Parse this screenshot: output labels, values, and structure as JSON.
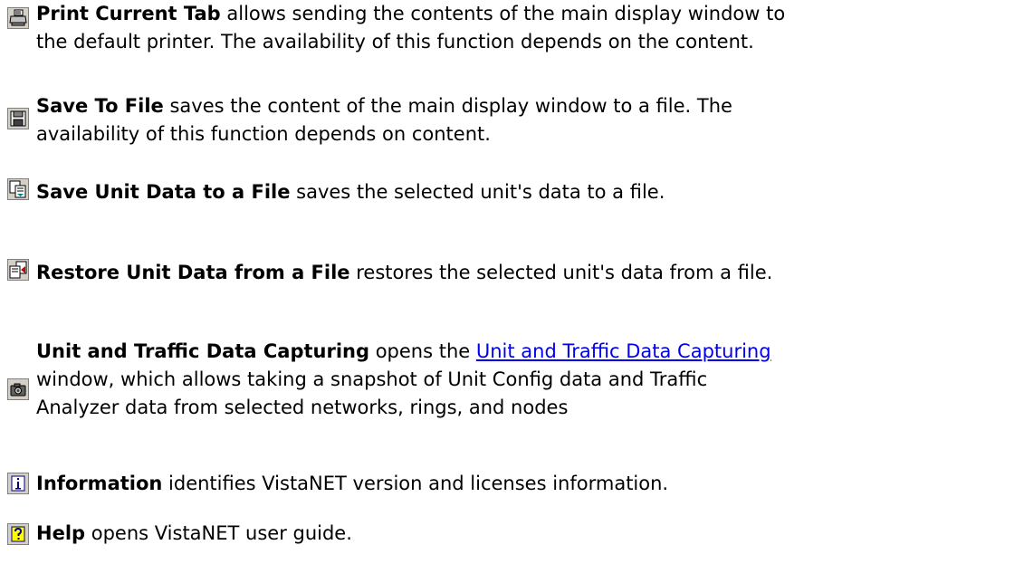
{
  "items": [
    {
      "icon": "printer-icon",
      "term": "Print Current Tab",
      "lines": [
        " allows sending the contents of the main display window to",
        "the default printer. The availability of this function depends on the content."
      ]
    },
    {
      "icon": "floppy-disk-icon",
      "term": "Save To File",
      "lines": [
        " saves the content of the main display window to a file. The",
        "availability of this function depends on content."
      ]
    },
    {
      "icon": "save-unit-data-icon",
      "term": "Save Unit Data to a File",
      "lines": [
        " saves the selected unit's data to a file."
      ]
    },
    {
      "icon": "restore-unit-data-icon",
      "term": "Restore Unit Data from a File",
      "lines": [
        " restores the selected unit's data from a file."
      ]
    },
    {
      "icon": "camera-icon",
      "term": "Unit and Traffic Data Capturing",
      "pre_link": " opens the ",
      "link": "Unit and Traffic Data Capturing",
      "lines": [
        "window, which allows taking a snapshot of Unit Config data and Traffic",
        "Analyzer data from selected networks, rings, and nodes"
      ]
    },
    {
      "icon": "information-icon",
      "term": "Information",
      "lines": [
        " identifies VistaNET version and licenses information."
      ]
    },
    {
      "icon": "help-icon",
      "term": "Help",
      "lines": [
        " opens VistaNET user guide."
      ]
    }
  ]
}
